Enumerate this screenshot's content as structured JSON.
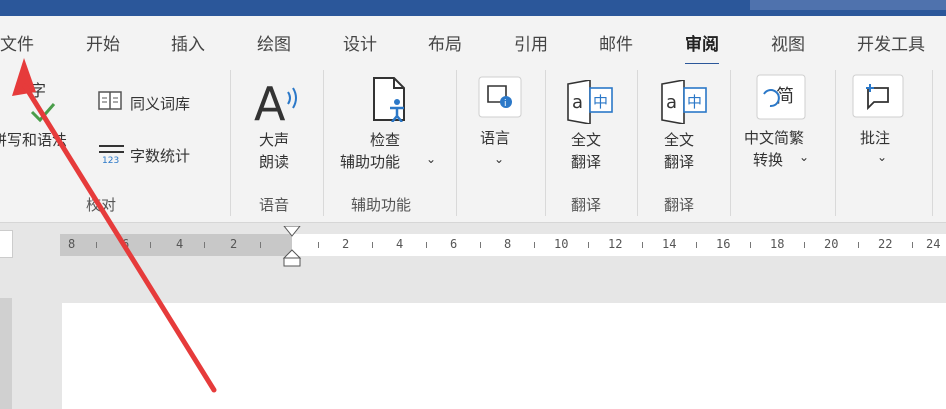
{
  "tabs": [
    "文件",
    "开始",
    "插入",
    "绘图",
    "设计",
    "布局",
    "引用",
    "邮件",
    "审阅",
    "视图",
    "开发工具"
  ],
  "active_tab": "审阅",
  "proofing": {
    "spelling_label": "拼写和语法",
    "thesaurus_label": "同义词库",
    "wordcount_label": "字数统计",
    "group_label": "校对"
  },
  "speech": {
    "read_aloud_line1": "大声",
    "read_aloud_line2": "朗读",
    "group_label": "语音"
  },
  "accessibility": {
    "check_line1": "检查",
    "check_line2": "辅助功能",
    "group_label": "辅助功能"
  },
  "language": {
    "label": "语言"
  },
  "translate1": {
    "line1": "全文",
    "line2": "翻译",
    "group_label": "翻译"
  },
  "translate2": {
    "line1": "全文",
    "line2": "翻译",
    "group_label": "翻译"
  },
  "chinese_conversion": {
    "line1": "中文简繁",
    "line2": "转换",
    "icon_glyph": "简"
  },
  "comments": {
    "label": "批注"
  },
  "ruler": {
    "numbers": [
      "8",
      "6",
      "4",
      "2",
      "2",
      "4",
      "6",
      "8",
      "10",
      "12",
      "14",
      "16",
      "18",
      "20",
      "22",
      "24"
    ]
  },
  "colors": {
    "title_bar": "#2b579a",
    "ribbon_bg": "#f3f3f3",
    "arrow": "#e63b3b"
  }
}
